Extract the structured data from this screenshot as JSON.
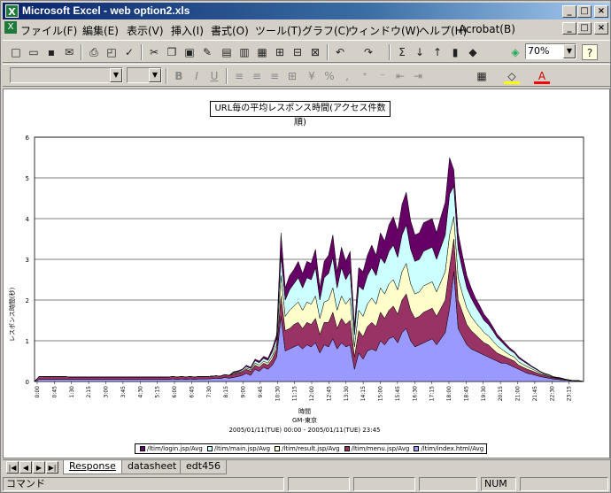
{
  "window": {
    "title": "Microsoft Excel - web option2.xls",
    "min": "_",
    "max": "□",
    "close": "×"
  },
  "menu": [
    "ファイル(F)",
    "編集(E)",
    "表示(V)",
    "挿入(I)",
    "書式(O)",
    "ツール(T)",
    "グラフ(C)",
    "ウィンドウ(W)",
    "ヘルプ(H)",
    "Acrobat(B)"
  ],
  "toolbar": {
    "zoom": "70%",
    "help": "?"
  },
  "chart_data": {
    "type": "area",
    "title": "URL毎の平均レスポンス時間(アクセス件数順)",
    "xlabel": "時間",
    "xlabel2": "GM-東京",
    "subtitle": "2005/01/11(TUE) 00:00 - 2005/01/11(TUE) 23:45",
    "ylabel": "レスポンス時間(秒)",
    "ylim": [
      0,
      6
    ],
    "yticks": [
      "0",
      "1",
      "2",
      "3",
      "4",
      "5",
      "6"
    ],
    "xticks": [
      "0:00",
      "0:45",
      "1:30",
      "2:15",
      "3:00",
      "3:45",
      "4:30",
      "5:15",
      "6:00",
      "6:45",
      "7:30",
      "8:15",
      "9:00",
      "9:45",
      "10:30",
      "11:15",
      "12:00",
      "12:45",
      "13:30",
      "14:15",
      "15:00",
      "15:45",
      "16:30",
      "17:15",
      "18:00",
      "18:45",
      "19:30",
      "20:15",
      "21:00",
      "21:45",
      "22:30",
      "23:15"
    ],
    "series": [
      {
        "name": "/ltim/index.html/Avg",
        "color": "#9999ff",
        "values": [
          0,
          0.05,
          0.05,
          0.05,
          0.05,
          0.05,
          0.05,
          0.05,
          0.05,
          0.05,
          0.05,
          0.05,
          0.05,
          0.05,
          0.05,
          0.05,
          0.05,
          0.05,
          0.05,
          0.05,
          0.05,
          0.05,
          0.05,
          0.05,
          0.05,
          0.05,
          0.05,
          0.05,
          0.05,
          0.05,
          0.05,
          0.05,
          0.06,
          0.05,
          0.06,
          0.05,
          0.06,
          0.05,
          0.06,
          0.06,
          0.06,
          0.07,
          0.08,
          0.07,
          0.1,
          0.08,
          0.1,
          0.12,
          0.15,
          0.2,
          0.15,
          0.3,
          0.25,
          0.35,
          0.3,
          0.4,
          0.6,
          1.6,
          0.75,
          0.8,
          0.85,
          0.9,
          0.8,
          0.9,
          0.85,
          0.95,
          0.7,
          0.9,
          0.85,
          1.05,
          0.8,
          0.95,
          0.85,
          0.9,
          0.3,
          0.7,
          0.55,
          0.75,
          0.8,
          0.75,
          1.0,
          0.9,
          1.05,
          1.1,
          0.95,
          1.2,
          1.3,
          1.0,
          0.85,
          0.9,
          0.95,
          1.0,
          1.05,
          0.9,
          1.05,
          1.2,
          1.8,
          2.7,
          1.3,
          1.1,
          0.9,
          0.8,
          0.75,
          0.7,
          0.65,
          0.6,
          0.55,
          0.5,
          0.45,
          0.45,
          0.4,
          0.35,
          0.3,
          0.25,
          0.2,
          0.18,
          0.15,
          0.12,
          0.1,
          0.08,
          0.06,
          0.05,
          0.04,
          0.03,
          0.02,
          0.01,
          0.01,
          0
        ]
      },
      {
        "name": "/ltim/menu.jsp/Avg",
        "color": "#993366",
        "values": [
          0,
          0.07,
          0.07,
          0.07,
          0.07,
          0.07,
          0.07,
          0.07,
          0.06,
          0.06,
          0.06,
          0.06,
          0.06,
          0.06,
          0.06,
          0.06,
          0.06,
          0.06,
          0.06,
          0.06,
          0.06,
          0.06,
          0.06,
          0.06,
          0.06,
          0.06,
          0.06,
          0.06,
          0.06,
          0.06,
          0.06,
          0.06,
          0.06,
          0.06,
          0.06,
          0.06,
          0.06,
          0.06,
          0.06,
          0.06,
          0.06,
          0.06,
          0.06,
          0.06,
          0.07,
          0.07,
          0.08,
          0.08,
          0.08,
          0.1,
          0.1,
          0.1,
          0.1,
          0.1,
          0.1,
          0.15,
          0.2,
          0.5,
          0.5,
          0.5,
          0.55,
          0.55,
          0.5,
          0.55,
          0.55,
          0.6,
          0.45,
          0.55,
          0.6,
          0.65,
          0.5,
          0.6,
          0.55,
          0.6,
          0.3,
          0.55,
          0.55,
          0.6,
          0.65,
          0.6,
          0.7,
          0.65,
          0.7,
          0.75,
          0.7,
          0.8,
          0.85,
          0.75,
          0.7,
          0.7,
          0.75,
          0.75,
          0.75,
          0.7,
          0.75,
          0.8,
          1.0,
          0.8,
          0.7,
          0.6,
          0.5,
          0.45,
          0.4,
          0.35,
          0.3,
          0.3,
          0.25,
          0.2,
          0.2,
          0.15,
          0.15,
          0.15,
          0.1,
          0.1,
          0.1,
          0.08,
          0.07,
          0.06,
          0.05,
          0.04,
          0.03,
          0.03,
          0.02,
          0.02,
          0.01,
          0.01,
          0.01,
          0
        ]
      },
      {
        "name": "/ltim/result.jsp/Avg",
        "color": "#ffffcc",
        "values": [
          0,
          0,
          0,
          0,
          0,
          0,
          0,
          0,
          0,
          0,
          0,
          0,
          0,
          0,
          0,
          0,
          0,
          0,
          0,
          0,
          0,
          0,
          0,
          0,
          0,
          0,
          0,
          0,
          0,
          0,
          0,
          0,
          0,
          0,
          0,
          0,
          0,
          0,
          0,
          0,
          0,
          0,
          0,
          0,
          0,
          0,
          0.02,
          0.02,
          0.02,
          0.03,
          0.03,
          0.05,
          0.05,
          0.05,
          0.05,
          0.08,
          0.1,
          0.5,
          0.35,
          0.45,
          0.45,
          0.5,
          0.45,
          0.5,
          0.5,
          0.55,
          0.4,
          0.5,
          0.55,
          0.6,
          0.45,
          0.55,
          0.5,
          0.55,
          0.25,
          0.5,
          0.5,
          0.55,
          0.6,
          0.55,
          0.6,
          0.6,
          0.65,
          0.65,
          0.6,
          0.7,
          0.75,
          0.65,
          0.6,
          0.6,
          0.65,
          0.65,
          0.65,
          0.6,
          0.65,
          0.7,
          0.8,
          0.55,
          0.55,
          0.45,
          0.4,
          0.35,
          0.3,
          0.28,
          0.25,
          0.22,
          0.2,
          0.18,
          0.15,
          0.12,
          0.1,
          0.1,
          0.08,
          0.07,
          0.06,
          0.05,
          0.04,
          0.03,
          0.02,
          0.02,
          0.01,
          0.01,
          0.01,
          0,
          0,
          0,
          0,
          0
        ]
      },
      {
        "name": "/ltim/main.jsp/Avg",
        "color": "#ccffff",
        "values": [
          0,
          0,
          0,
          0,
          0,
          0,
          0,
          0,
          0,
          0,
          0,
          0,
          0,
          0,
          0,
          0,
          0,
          0,
          0,
          0,
          0,
          0,
          0,
          0,
          0,
          0,
          0,
          0,
          0,
          0,
          0,
          0,
          0,
          0,
          0,
          0,
          0,
          0,
          0,
          0,
          0,
          0,
          0,
          0,
          0,
          0,
          0.02,
          0.02,
          0.03,
          0.04,
          0.04,
          0.06,
          0.06,
          0.07,
          0.07,
          0.1,
          0.15,
          0.5,
          0.4,
          0.5,
          0.55,
          0.6,
          0.55,
          0.6,
          0.6,
          0.7,
          0.45,
          0.6,
          0.65,
          0.75,
          0.55,
          0.7,
          0.6,
          0.65,
          0.3,
          0.6,
          0.65,
          0.7,
          0.75,
          0.7,
          0.75,
          0.75,
          0.8,
          0.85,
          0.8,
          0.9,
          0.95,
          0.85,
          0.8,
          0.8,
          0.85,
          0.85,
          0.85,
          0.8,
          0.85,
          0.9,
          1.0,
          0.75,
          0.7,
          0.6,
          0.5,
          0.45,
          0.4,
          0.35,
          0.3,
          0.28,
          0.25,
          0.2,
          0.18,
          0.15,
          0.12,
          0.1,
          0.09,
          0.08,
          0.07,
          0.05,
          0.04,
          0.03,
          0.02,
          0.02,
          0.01,
          0.01,
          0.01,
          0,
          0,
          0,
          0,
          0
        ]
      },
      {
        "name": "/ltim/login.jsp/Avg",
        "color": "#660066",
        "values": [
          0,
          0,
          0,
          0,
          0,
          0,
          0,
          0,
          0,
          0,
          0,
          0,
          0,
          0,
          0,
          0,
          0,
          0,
          0,
          0,
          0,
          0,
          0,
          0,
          0,
          0,
          0,
          0,
          0,
          0,
          0,
          0,
          0,
          0,
          0,
          0,
          0,
          0,
          0,
          0,
          0,
          0,
          0,
          0,
          0,
          0,
          0.02,
          0.02,
          0.02,
          0.03,
          0.03,
          0.04,
          0.04,
          0.05,
          0.05,
          0.08,
          0.1,
          0.55,
          0.3,
          0.35,
          0.35,
          0.4,
          0.35,
          0.4,
          0.4,
          0.45,
          0.3,
          0.4,
          0.45,
          0.55,
          0.4,
          0.5,
          0.45,
          0.5,
          0.2,
          0.45,
          0.45,
          0.5,
          0.55,
          0.5,
          0.6,
          0.55,
          0.65,
          0.7,
          0.65,
          0.75,
          0.8,
          0.7,
          0.65,
          0.65,
          0.7,
          0.7,
          0.7,
          0.65,
          0.75,
          0.8,
          0.9,
          0.4,
          0.4,
          0.35,
          0.3,
          0.25,
          0.2,
          0.18,
          0.15,
          0.12,
          0.1,
          0.08,
          0.07,
          0.06,
          0.05,
          0.04,
          0.04,
          0.03,
          0.03,
          0.02,
          0.02,
          0.01,
          0.01,
          0.01,
          0.01,
          0,
          0,
          0,
          0,
          0,
          0,
          0
        ]
      }
    ]
  },
  "tabs": [
    "Response",
    "datasheet",
    "edt456"
  ],
  "status": {
    "left": "コマンド",
    "num": "NUM"
  }
}
